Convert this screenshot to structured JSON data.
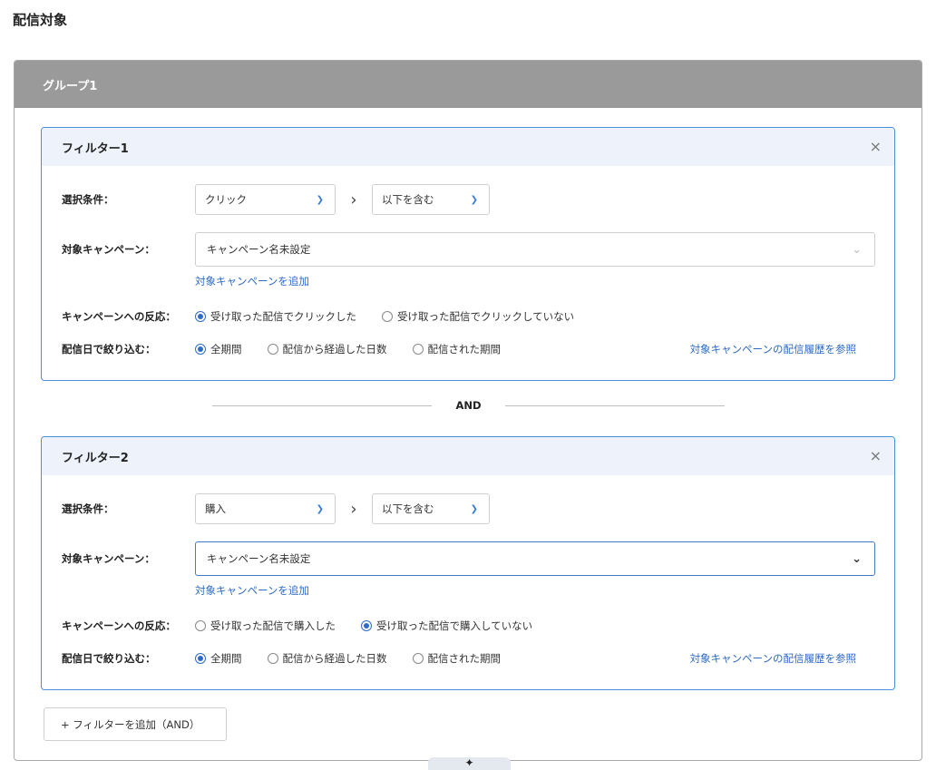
{
  "page": {
    "title": "配信対象"
  },
  "group": {
    "title": "グループ1"
  },
  "filters": [
    {
      "title": "フィルター1",
      "close": "×",
      "condition_label": "選択条件：",
      "condition_value": "クリック",
      "operator_value": "以下を含む",
      "campaign_label": "対象キャンペーン：",
      "campaign_value": "キャンペーン名未設定",
      "add_campaign": "対象キャンペーンを追加",
      "reaction_label": "キャンペーンへの反応：",
      "reaction_options": [
        "受け取った配信でクリックした",
        "受け取った配信でクリックしていない"
      ],
      "reaction_selected": 0,
      "date_label": "配信日で絞り込む：",
      "date_options": [
        "全期間",
        "配信から経過した日数",
        "配信された期間"
      ],
      "date_selected": 0,
      "history_link": "対象キャンペーンの配信履歴を参照"
    },
    {
      "title": "フィルター2",
      "close": "×",
      "condition_label": "選択条件：",
      "condition_value": "購入",
      "operator_value": "以下を含む",
      "campaign_label": "対象キャンペーン：",
      "campaign_value": "キャンペーン名未設定",
      "add_campaign": "対象キャンペーンを追加",
      "reaction_label": "キャンペーンへの反応：",
      "reaction_options": [
        "受け取った配信で購入した",
        "受け取った配信で購入していない"
      ],
      "reaction_selected": 1,
      "date_label": "配信日で絞り込む：",
      "date_options": [
        "全期間",
        "配信から経過した日数",
        "配信された期間"
      ],
      "date_selected": 0,
      "history_link": "対象キャンペーンの配信履歴を参照"
    }
  ],
  "separator": {
    "label": "AND"
  },
  "add_filter_button": "+ フィルターを追加（AND）",
  "drag_handle": "✦",
  "colors": {
    "accent": "#2e6bc6",
    "group_header": "#9a9a9a",
    "filter_border": "#4a90d9",
    "filter_header": "#eef3fb"
  }
}
